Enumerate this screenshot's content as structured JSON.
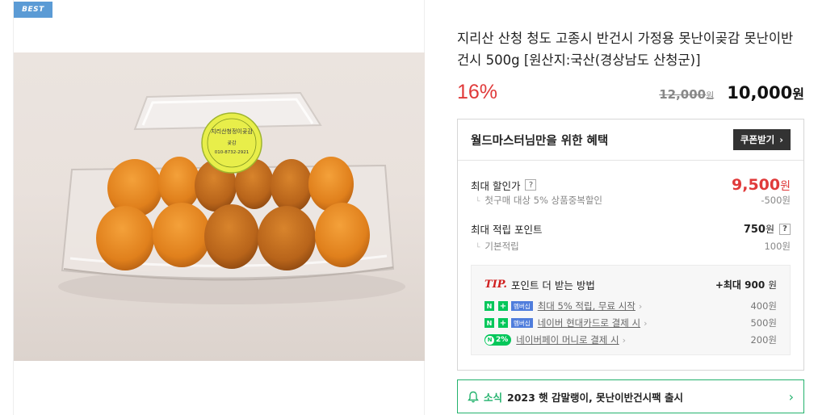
{
  "image": {
    "badge": "BEST",
    "sticker_lines": [
      "지리산청정이곶감",
      "곶감",
      "010-8732-2921"
    ]
  },
  "product": {
    "title": "지리산 산청 청도 고종시 반건시 가정용 못난이곶감 못난이반건시 500g [원산지:국산(경상남도 산청군)]",
    "discount_rate": "16%",
    "original_price": "12,000",
    "sale_price": "10,000",
    "currency": "원"
  },
  "benefits": {
    "heading": "월드마스터님만을 위한 혜택",
    "coupon_button": "쿠폰받기",
    "max_discount": {
      "label": "최대 할인가",
      "value": "9,500",
      "sub_label": "첫구매 대상 5% 상품중복할인",
      "sub_value": "-500원"
    },
    "max_points": {
      "label": "최대 적립 포인트",
      "value": "750",
      "sub_label": "기본적립",
      "sub_value": "100원"
    },
    "tip": {
      "mark": "TIP.",
      "title": "포인트 더 받는 방법",
      "max_prefix": "+최대",
      "max_value": "900",
      "items": [
        {
          "badge_n": "N",
          "badge_plus": "+",
          "badge_member": "멤버십",
          "text": "최대 5% 적립, 무료 시작",
          "amount": "400원"
        },
        {
          "badge_n": "N",
          "badge_plus": "+",
          "badge_member": "멤버십",
          "text": "네이버 현대카드로 결제 시",
          "amount": "500원"
        },
        {
          "badge_pay": "2%",
          "text": "네이버페이 머니로 결제 시",
          "amount": "200원"
        }
      ]
    }
  },
  "news": {
    "tag": "소식",
    "text": "2023 햇 감말랭이, 못난이반건시팩 출시"
  },
  "colors": {
    "accent_red": "#e03a3a",
    "naver_green": "#03c75a",
    "news_green": "#23b26d",
    "best_badge": "#5b9bd5"
  }
}
